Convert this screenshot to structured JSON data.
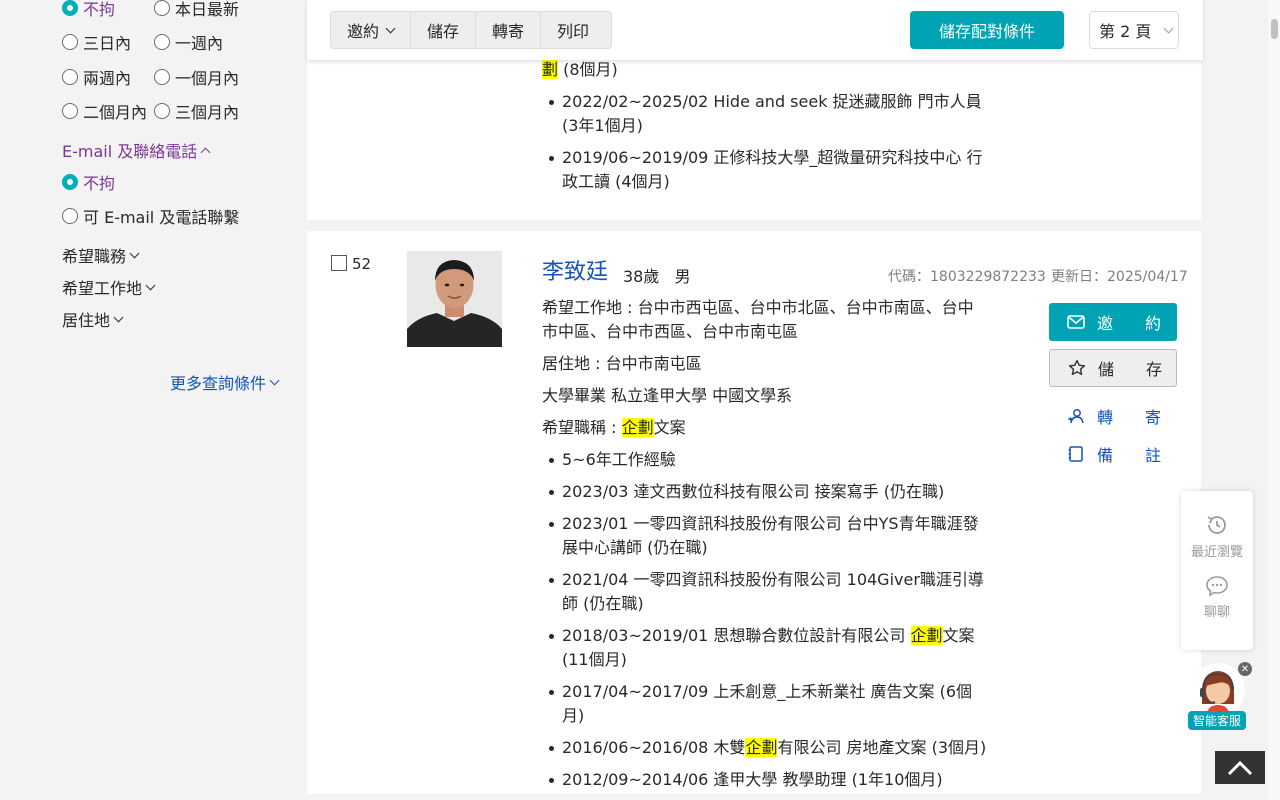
{
  "colors": {
    "accent": "#00a3b4",
    "link": "#1654b9",
    "purple": "#7e3794",
    "highlight": "#ffff00"
  },
  "sidebar": {
    "update_time_options": [
      {
        "label": "不拘",
        "selected": true
      },
      {
        "label": "本日最新",
        "selected": false
      },
      {
        "label": "三日內",
        "selected": false
      },
      {
        "label": "一週內",
        "selected": false
      },
      {
        "label": "兩週內",
        "selected": false
      },
      {
        "label": "一個月內",
        "selected": false
      },
      {
        "label": "二個月內",
        "selected": false
      },
      {
        "label": "三個月內",
        "selected": false
      }
    ],
    "contact_section": {
      "title": "E-mail 及聯絡電話",
      "options": [
        {
          "label": "不拘",
          "selected": true
        },
        {
          "label": "可 E-mail 及電話聯繫",
          "selected": false
        }
      ]
    },
    "filters": [
      "希望職務",
      "希望工作地",
      "居住地"
    ],
    "more_conditions": "更多查詢條件"
  },
  "toolbar": {
    "invite": "邀約",
    "save": "儲存",
    "forward": "轉寄",
    "print": "列印",
    "save_match": "儲存配對條件",
    "page": "第 2 頁"
  },
  "prev_card": {
    "frag_hl": "劃",
    "frag_rest": " (8個月)",
    "items": [
      "2022/02~2025/02 Hide and seek 捉迷藏服飾 門市人員 (3年1個月)",
      "2019/06~2019/09 正修科技大學_超微量研究科技中心 行政工讀 (4個月)"
    ]
  },
  "candidate": {
    "index": "52",
    "name": "李致廷",
    "age": "38歲",
    "sex": "男",
    "code": "代碼：1803229872233",
    "updated": "更新日：2025/04/17",
    "location": "希望工作地 : 台中市西屯區、台中市北區、台中市南區、台中市中區、台中市西區、台中市南屯區",
    "residence": "居住地 : 台中市南屯區",
    "education": "大學畢業 私立逢甲大學 中國文學系",
    "job_prefix": "希望職稱 : ",
    "job_hl": "企劃",
    "job_suffix": "文案",
    "experience": [
      {
        "pre": "5~6年工作經驗",
        "hl": "",
        "post": ""
      },
      {
        "pre": "2023/03 達文西數位科技有限公司 接案寫手 (仍在職)",
        "hl": "",
        "post": ""
      },
      {
        "pre": "2023/01 一零四資訊科技股份有限公司 台中YS青年職涯發展中心講師 (仍在職)",
        "hl": "",
        "post": ""
      },
      {
        "pre": "2021/04 一零四資訊科技股份有限公司 104Giver職涯引導師 (仍在職)",
        "hl": "",
        "post": ""
      },
      {
        "pre": "2018/03~2019/01 思想聯合數位設計有限公司 ",
        "hl": "企劃",
        "post": "文案 (11個月)"
      },
      {
        "pre": "2017/04~2017/09 上禾創意_上禾新業社 廣告文案 (6個月)",
        "hl": "",
        "post": ""
      },
      {
        "pre": "2016/06~2016/08 木雙",
        "hl": "企劃",
        "post": "有限公司 房地產文案 (3個月)"
      },
      {
        "pre": "2012/09~2014/06 逢甲大學 教學助理 (1年10個月)",
        "hl": "",
        "post": ""
      }
    ],
    "actions": {
      "invite": [
        "邀",
        "約"
      ],
      "save": [
        "儲",
        "存"
      ],
      "forward": [
        "轉",
        "寄"
      ],
      "note": [
        "備",
        "註"
      ]
    }
  },
  "float": {
    "recent": "最近瀏覽",
    "chat": "聊聊",
    "bot": "智能客服"
  }
}
